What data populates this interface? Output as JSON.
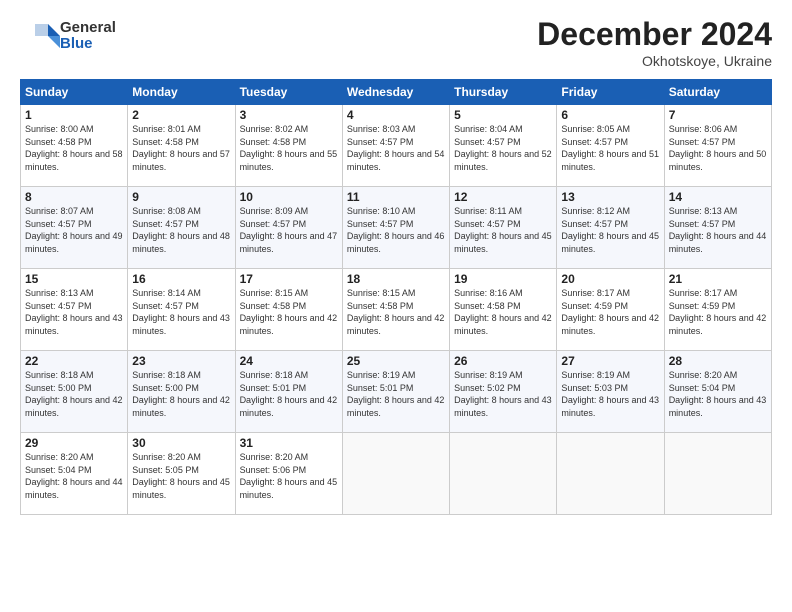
{
  "logo": {
    "general": "General",
    "blue": "Blue"
  },
  "header": {
    "month": "December 2024",
    "location": "Okhotskoye, Ukraine"
  },
  "weekdays": [
    "Sunday",
    "Monday",
    "Tuesday",
    "Wednesday",
    "Thursday",
    "Friday",
    "Saturday"
  ],
  "weeks": [
    [
      {
        "day": "1",
        "sunrise": "8:00 AM",
        "sunset": "4:58 PM",
        "daylight": "8 hours and 58 minutes."
      },
      {
        "day": "2",
        "sunrise": "8:01 AM",
        "sunset": "4:58 PM",
        "daylight": "8 hours and 57 minutes."
      },
      {
        "day": "3",
        "sunrise": "8:02 AM",
        "sunset": "4:58 PM",
        "daylight": "8 hours and 55 minutes."
      },
      {
        "day": "4",
        "sunrise": "8:03 AM",
        "sunset": "4:57 PM",
        "daylight": "8 hours and 54 minutes."
      },
      {
        "day": "5",
        "sunrise": "8:04 AM",
        "sunset": "4:57 PM",
        "daylight": "8 hours and 52 minutes."
      },
      {
        "day": "6",
        "sunrise": "8:05 AM",
        "sunset": "4:57 PM",
        "daylight": "8 hours and 51 minutes."
      },
      {
        "day": "7",
        "sunrise": "8:06 AM",
        "sunset": "4:57 PM",
        "daylight": "8 hours and 50 minutes."
      }
    ],
    [
      {
        "day": "8",
        "sunrise": "8:07 AM",
        "sunset": "4:57 PM",
        "daylight": "8 hours and 49 minutes."
      },
      {
        "day": "9",
        "sunrise": "8:08 AM",
        "sunset": "4:57 PM",
        "daylight": "8 hours and 48 minutes."
      },
      {
        "day": "10",
        "sunrise": "8:09 AM",
        "sunset": "4:57 PM",
        "daylight": "8 hours and 47 minutes."
      },
      {
        "day": "11",
        "sunrise": "8:10 AM",
        "sunset": "4:57 PM",
        "daylight": "8 hours and 46 minutes."
      },
      {
        "day": "12",
        "sunrise": "8:11 AM",
        "sunset": "4:57 PM",
        "daylight": "8 hours and 45 minutes."
      },
      {
        "day": "13",
        "sunrise": "8:12 AM",
        "sunset": "4:57 PM",
        "daylight": "8 hours and 45 minutes."
      },
      {
        "day": "14",
        "sunrise": "8:13 AM",
        "sunset": "4:57 PM",
        "daylight": "8 hours and 44 minutes."
      }
    ],
    [
      {
        "day": "15",
        "sunrise": "8:13 AM",
        "sunset": "4:57 PM",
        "daylight": "8 hours and 43 minutes."
      },
      {
        "day": "16",
        "sunrise": "8:14 AM",
        "sunset": "4:57 PM",
        "daylight": "8 hours and 43 minutes."
      },
      {
        "day": "17",
        "sunrise": "8:15 AM",
        "sunset": "4:58 PM",
        "daylight": "8 hours and 42 minutes."
      },
      {
        "day": "18",
        "sunrise": "8:15 AM",
        "sunset": "4:58 PM",
        "daylight": "8 hours and 42 minutes."
      },
      {
        "day": "19",
        "sunrise": "8:16 AM",
        "sunset": "4:58 PM",
        "daylight": "8 hours and 42 minutes."
      },
      {
        "day": "20",
        "sunrise": "8:17 AM",
        "sunset": "4:59 PM",
        "daylight": "8 hours and 42 minutes."
      },
      {
        "day": "21",
        "sunrise": "8:17 AM",
        "sunset": "4:59 PM",
        "daylight": "8 hours and 42 minutes."
      }
    ],
    [
      {
        "day": "22",
        "sunrise": "8:18 AM",
        "sunset": "5:00 PM",
        "daylight": "8 hours and 42 minutes."
      },
      {
        "day": "23",
        "sunrise": "8:18 AM",
        "sunset": "5:00 PM",
        "daylight": "8 hours and 42 minutes."
      },
      {
        "day": "24",
        "sunrise": "8:18 AM",
        "sunset": "5:01 PM",
        "daylight": "8 hours and 42 minutes."
      },
      {
        "day": "25",
        "sunrise": "8:19 AM",
        "sunset": "5:01 PM",
        "daylight": "8 hours and 42 minutes."
      },
      {
        "day": "26",
        "sunrise": "8:19 AM",
        "sunset": "5:02 PM",
        "daylight": "8 hours and 43 minutes."
      },
      {
        "day": "27",
        "sunrise": "8:19 AM",
        "sunset": "5:03 PM",
        "daylight": "8 hours and 43 minutes."
      },
      {
        "day": "28",
        "sunrise": "8:20 AM",
        "sunset": "5:04 PM",
        "daylight": "8 hours and 43 minutes."
      }
    ],
    [
      {
        "day": "29",
        "sunrise": "8:20 AM",
        "sunset": "5:04 PM",
        "daylight": "8 hours and 44 minutes."
      },
      {
        "day": "30",
        "sunrise": "8:20 AM",
        "sunset": "5:05 PM",
        "daylight": "8 hours and 45 minutes."
      },
      {
        "day": "31",
        "sunrise": "8:20 AM",
        "sunset": "5:06 PM",
        "daylight": "8 hours and 45 minutes."
      },
      null,
      null,
      null,
      null
    ]
  ]
}
